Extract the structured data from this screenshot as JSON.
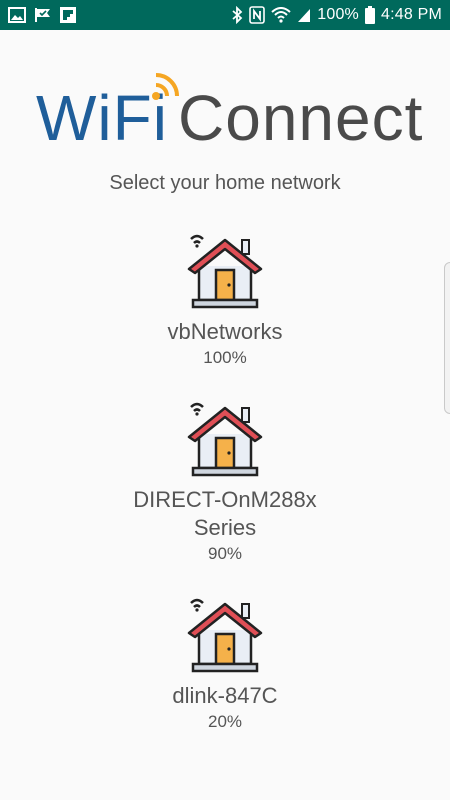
{
  "status_bar": {
    "left_icons": [
      "image-icon",
      "check-flag-icon",
      "flipboard-icon"
    ],
    "right_icons": [
      "bluetooth-icon",
      "nfc-icon",
      "wifi-icon",
      "cell-signal-icon",
      "battery-icon"
    ],
    "battery": "100%",
    "time": "4:48 PM",
    "background": "#00695c"
  },
  "header": {
    "logo_wifi": "WiFi",
    "logo_connect": "Connect",
    "subtitle": "Select your home network"
  },
  "networks": [
    {
      "name": "vbNetworks",
      "strength": "100%"
    },
    {
      "name": "DIRECT-OnM288x Series",
      "strength": "90%"
    },
    {
      "name": "dlink-847C",
      "strength": "20%"
    }
  ],
  "colors": {
    "logo_blue": "#1f5e9a",
    "logo_gray": "#4a4a4a",
    "logo_orange": "#f5a623",
    "roof_red": "#e04f56",
    "door_orange": "#f5b14a",
    "house_wall": "#e9eef5",
    "text": "#555555"
  }
}
